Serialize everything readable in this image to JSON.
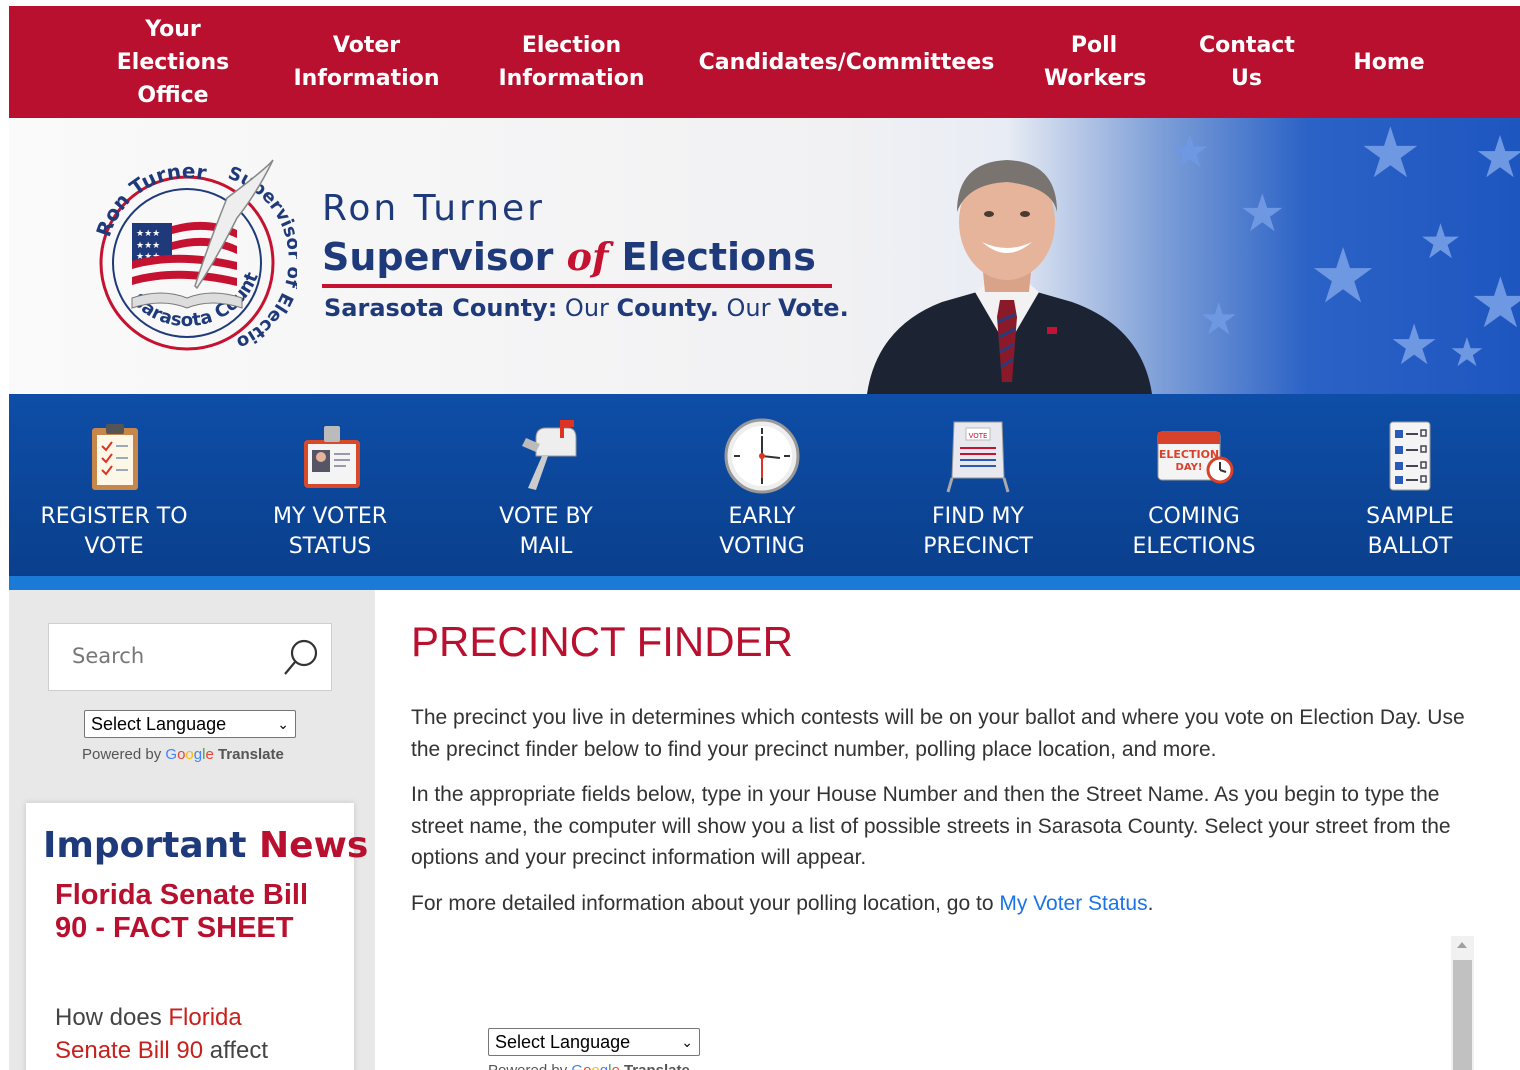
{
  "top_nav": {
    "items": [
      {
        "label": "Your Elections Office"
      },
      {
        "label": "Voter Information"
      },
      {
        "label": "Election Information"
      },
      {
        "label": "Candidates/Committees"
      },
      {
        "label": "Poll Workers"
      },
      {
        "label": "Contact Us"
      },
      {
        "label": "Home"
      }
    ]
  },
  "banner": {
    "seal_text_top": "Ron Turner",
    "seal_text_right": "Supervisor of Elections",
    "seal_text_left": "Sarasota County",
    "name": "Ron Turner",
    "title_part1": "Supervisor ",
    "title_of": "of",
    "title_part2": " Elections",
    "tag_bold1": "Sarasota County:",
    "tag_plain1": " Our ",
    "tag_bold2": "County.",
    "tag_plain2": " Our ",
    "tag_bold3": "Vote."
  },
  "quick_links": [
    {
      "label": "REGISTER TO VOTE",
      "icon": "clipboard-icon"
    },
    {
      "label": "MY VOTER STATUS",
      "icon": "id-badge-icon"
    },
    {
      "label": "VOTE BY MAIL",
      "icon": "mailbox-icon"
    },
    {
      "label": "EARLY VOTING",
      "icon": "clock-icon"
    },
    {
      "label": "FIND MY PRECINCT",
      "icon": "vote-sign-icon"
    },
    {
      "label": "COMING ELECTIONS",
      "icon": "election-calendar-icon"
    },
    {
      "label": "SAMPLE BALLOT",
      "icon": "ballot-icon"
    }
  ],
  "sidebar": {
    "search_placeholder": "Search",
    "language_select": "Select Language",
    "powered_by": "Powered by ",
    "translate": "Translate",
    "news_heading_1": "Important ",
    "news_heading_2": "News",
    "news_title": "Florida Senate Bill 90 - FACT SHEET",
    "news_body_1": "How does ",
    "news_body_link": "Florida Senate Bill 90",
    "news_body_2": " affect"
  },
  "main": {
    "title": "PRECINCT FINDER",
    "para1": "The precinct you live in determines which contests will be on your ballot and where you vote on Election Day. Use the precinct finder below to find your precinct number, polling place location, and more.",
    "para2": "In the appropriate fields below, type in your House Number and then the Street Name. As you begin to type the street name, the computer will show you a list of possible streets in Sarasota County. Select your street from the options and your precinct information will appear.",
    "para3_text": "For more detailed information about your polling location, go to ",
    "para3_link": "My Voter Status",
    "para3_end": ".",
    "frame_language_select": "Select Language",
    "frame_powered_by": "Powered by ",
    "frame_translate": "Translate"
  },
  "colors": {
    "brand_red": "#b8102e",
    "brand_navy": "#1f3a7a",
    "quick_blue": "#0e4ea8",
    "link_blue": "#1a73e8"
  }
}
